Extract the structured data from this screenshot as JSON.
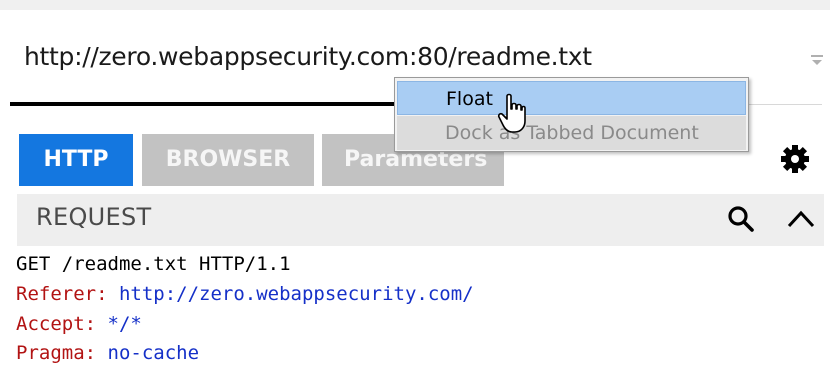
{
  "address": {
    "url": "http://zero.webappsecurity.com:80/readme.txt"
  },
  "tabs": [
    {
      "label": "HTTP",
      "active": true
    },
    {
      "label": "BROWSER",
      "active": false
    },
    {
      "label": "Parameters",
      "active": false
    }
  ],
  "settings": {
    "icon": "gear-icon"
  },
  "request_panel": {
    "title": "REQUEST",
    "icons": [
      "search-icon",
      "chevron-up-icon"
    ]
  },
  "request_lines": [
    {
      "text": "GET /readme.txt HTTP/1.1"
    },
    {
      "name": "Referer:",
      "value": "http://zero.webappsecurity.com/"
    },
    {
      "name": "Accept:",
      "value": "*/*"
    },
    {
      "name": "Pragma:",
      "value": "no-cache"
    }
  ],
  "context_menu": {
    "items": [
      {
        "label": "Float",
        "state": "highlighted"
      },
      {
        "label": "Dock as Tabbed Document",
        "state": "disabled"
      }
    ]
  },
  "colors": {
    "active_tab": "#1477e0",
    "inactive_tab": "#c2c2c2",
    "header_name": "#b21313",
    "header_value": "#1530c8",
    "menu_highlight": "#a9cdf3"
  }
}
